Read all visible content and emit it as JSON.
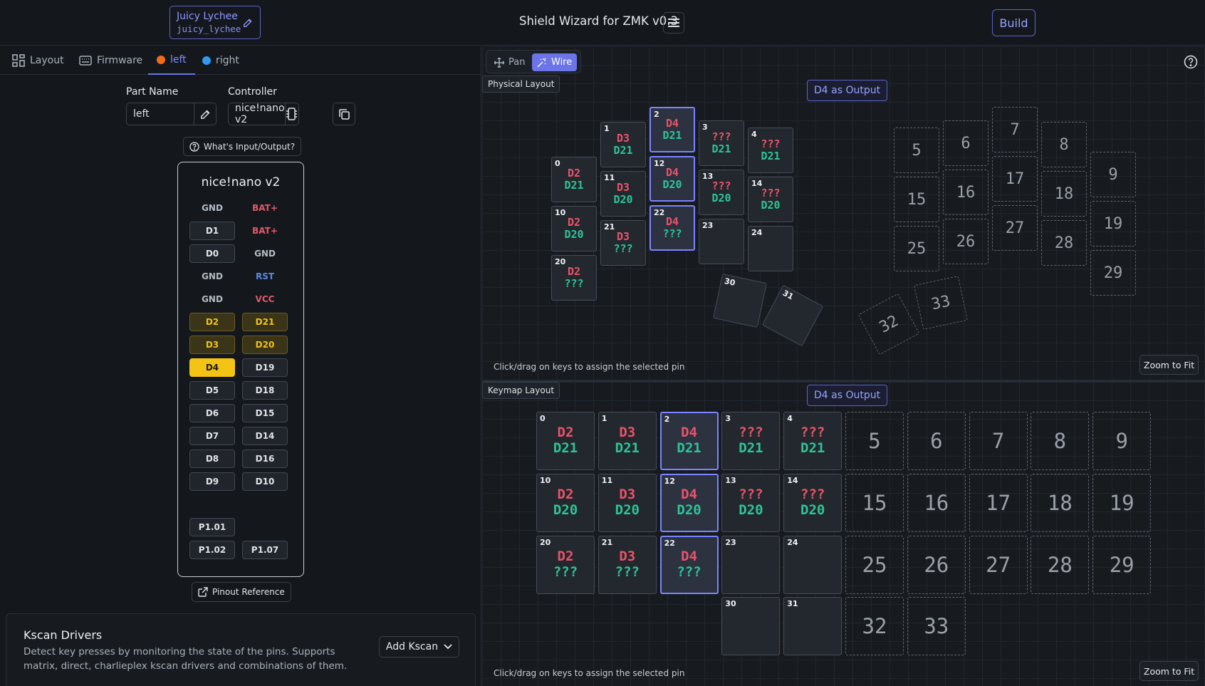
{
  "header": {
    "project_name": "Juicy Lychee",
    "project_slug": "juicy_lychee",
    "title": "Shield Wizard for ZMK v0.3",
    "build_label": "Build"
  },
  "tabs": [
    {
      "label": "Layout",
      "icon": "layout-grid-icon"
    },
    {
      "label": "Firmware",
      "icon": "keyboard-icon"
    },
    {
      "label": "left",
      "color": "#f26b1d",
      "active": true
    },
    {
      "label": "right",
      "color": "#2f9bf0"
    }
  ],
  "part": {
    "name_label": "Part Name",
    "name_value": "left",
    "controller_label": "Controller",
    "controller_value": "nice!nano v2",
    "io_help": "What's Input/Output?"
  },
  "controller": {
    "title": "nice!nano v2",
    "rows": [
      [
        {
          "t": "GND",
          "k": "txt"
        },
        {
          "t": "BAT+",
          "k": "bat"
        }
      ],
      [
        {
          "t": "D1",
          "k": "btn"
        },
        {
          "t": "BAT+",
          "k": "bat"
        }
      ],
      [
        {
          "t": "D0",
          "k": "btn"
        },
        {
          "t": "GND",
          "k": "txt"
        }
      ],
      [
        {
          "t": "GND",
          "k": "txt"
        },
        {
          "t": "RST",
          "k": "rst"
        }
      ],
      [
        {
          "t": "GND",
          "k": "txt"
        },
        {
          "t": "VCC",
          "k": "vcc"
        }
      ],
      [
        {
          "t": "D2",
          "k": "used"
        },
        {
          "t": "D21",
          "k": "used"
        }
      ],
      [
        {
          "t": "D3",
          "k": "used"
        },
        {
          "t": "D20",
          "k": "used"
        }
      ],
      [
        {
          "t": "D4",
          "k": "sel"
        },
        {
          "t": "D19",
          "k": "btn"
        }
      ],
      [
        {
          "t": "D5",
          "k": "btn"
        },
        {
          "t": "D18",
          "k": "btn"
        }
      ],
      [
        {
          "t": "D6",
          "k": "btn"
        },
        {
          "t": "D15",
          "k": "btn"
        }
      ],
      [
        {
          "t": "D7",
          "k": "btn"
        },
        {
          "t": "D14",
          "k": "btn"
        }
      ],
      [
        {
          "t": "D8",
          "k": "btn"
        },
        {
          "t": "D16",
          "k": "btn"
        }
      ],
      [
        {
          "t": "D9",
          "k": "btn"
        },
        {
          "t": "D10",
          "k": "btn"
        }
      ],
      [
        null,
        null
      ],
      [
        {
          "t": "P1.01",
          "k": "btn"
        },
        null
      ],
      [
        {
          "t": "P1.02",
          "k": "btn"
        },
        {
          "t": "P1.07",
          "k": "btn"
        }
      ]
    ],
    "pinout_label": "Pinout Reference"
  },
  "kscan": {
    "title": "Kscan Drivers",
    "description": "Detect key presses by monitoring the state of the pins. Supports matrix, direct, charlieplex kscan drivers and combinations of them.",
    "add_label": "Add Kscan"
  },
  "tools": {
    "pan": "Pan",
    "wire": "Wire"
  },
  "physical": {
    "label": "Physical Layout",
    "badge": "D4 as Output",
    "hint": "Click/drag on keys to assign the selected pin",
    "zoom": "Zoom to Fit"
  },
  "keymap": {
    "label": "Keymap Layout",
    "badge": "D4 as Output",
    "hint": "Click/drag on keys to assign the selected pin",
    "zoom": "Zoom to Fit"
  },
  "keys": [
    {
      "i": 0,
      "a": "D2",
      "b": "D21"
    },
    {
      "i": 1,
      "a": "D3",
      "b": "D21"
    },
    {
      "i": 2,
      "a": "D4",
      "b": "D21",
      "sel": true
    },
    {
      "i": 3,
      "a": "???",
      "b": "D21"
    },
    {
      "i": 4,
      "a": "???",
      "b": "D21"
    },
    {
      "i": 10,
      "a": "D2",
      "b": "D20"
    },
    {
      "i": 11,
      "a": "D3",
      "b": "D20"
    },
    {
      "i": 12,
      "a": "D4",
      "b": "D20",
      "sel": true
    },
    {
      "i": 13,
      "a": "???",
      "b": "D20"
    },
    {
      "i": 14,
      "a": "???",
      "b": "D20"
    },
    {
      "i": 20,
      "a": "D2",
      "b": "???"
    },
    {
      "i": 21,
      "a": "D3",
      "b": "???"
    },
    {
      "i": 22,
      "a": "D4",
      "b": "???",
      "sel": true
    },
    {
      "i": 23
    },
    {
      "i": 24
    },
    {
      "i": 30
    },
    {
      "i": 31
    }
  ],
  "ghost_keys": [
    5,
    6,
    7,
    8,
    9,
    15,
    16,
    17,
    18,
    19,
    25,
    26,
    27,
    28,
    29,
    32,
    33
  ],
  "colors": {
    "accent": "#6c75e8",
    "output_pin": "#e8546a",
    "input_pin": "#2ec496",
    "selected_pin": "#f4c414"
  }
}
